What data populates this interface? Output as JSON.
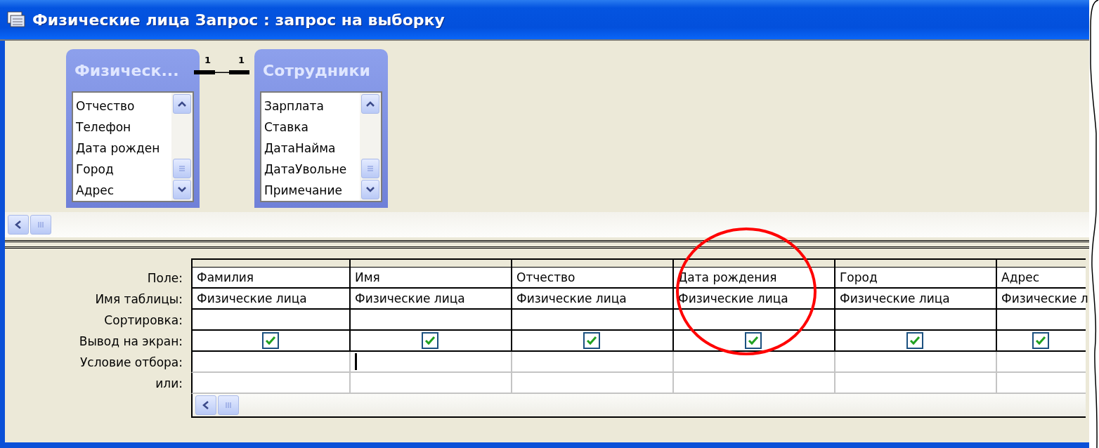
{
  "window": {
    "title": "Физические лица Запрос : запрос на выборку"
  },
  "tables": [
    {
      "title": "Физическ...",
      "fields": [
        "Отчество",
        "Телефон",
        "Дата рожден",
        "Город",
        "Адрес"
      ]
    },
    {
      "title": "Сотрудники",
      "fields": [
        "Зарплата",
        "Ставка",
        "ДатаНайма",
        "ДатаУвольне",
        "Примечание"
      ]
    }
  ],
  "relationship": {
    "left_label": "1",
    "right_label": "1"
  },
  "grid": {
    "row_labels": [
      "Поле:",
      "Имя таблицы:",
      "Сортировка:",
      "Вывод на экран:",
      "Условие отбора:",
      "или:"
    ],
    "columns": [
      {
        "field": "Фамилия",
        "table": "Физические лица",
        "show": true,
        "editing": false
      },
      {
        "field": "Имя",
        "table": "Физические лица",
        "show": true,
        "editing": true
      },
      {
        "field": "Отчество",
        "table": "Физические лица",
        "show": true,
        "editing": false
      },
      {
        "field": "Дата рождения",
        "table": "Физические лица",
        "show": true,
        "editing": false
      },
      {
        "field": "Город",
        "table": "Физические лица",
        "show": true,
        "editing": false
      },
      {
        "field": "Адрес",
        "table": "Физические л",
        "show": true,
        "editing": false
      }
    ]
  }
}
